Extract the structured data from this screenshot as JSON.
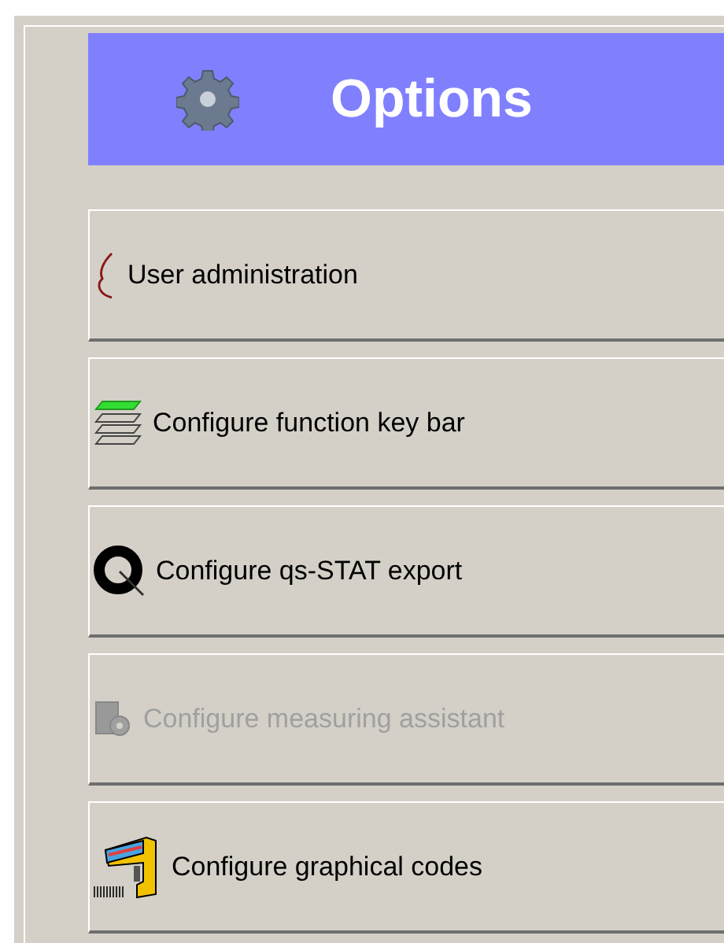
{
  "header": {
    "title": "Options"
  },
  "items": [
    {
      "label": "User administration",
      "kind": "user",
      "disabled": false
    },
    {
      "label": "Configure function key bar",
      "kind": "layers",
      "disabled": false
    },
    {
      "label": "Configure qs-STAT export",
      "kind": "q",
      "disabled": false
    },
    {
      "label": "Configure measuring assistant",
      "kind": "assistant",
      "disabled": true
    },
    {
      "label": "Configure graphical codes",
      "kind": "scanner",
      "disabled": false
    }
  ]
}
